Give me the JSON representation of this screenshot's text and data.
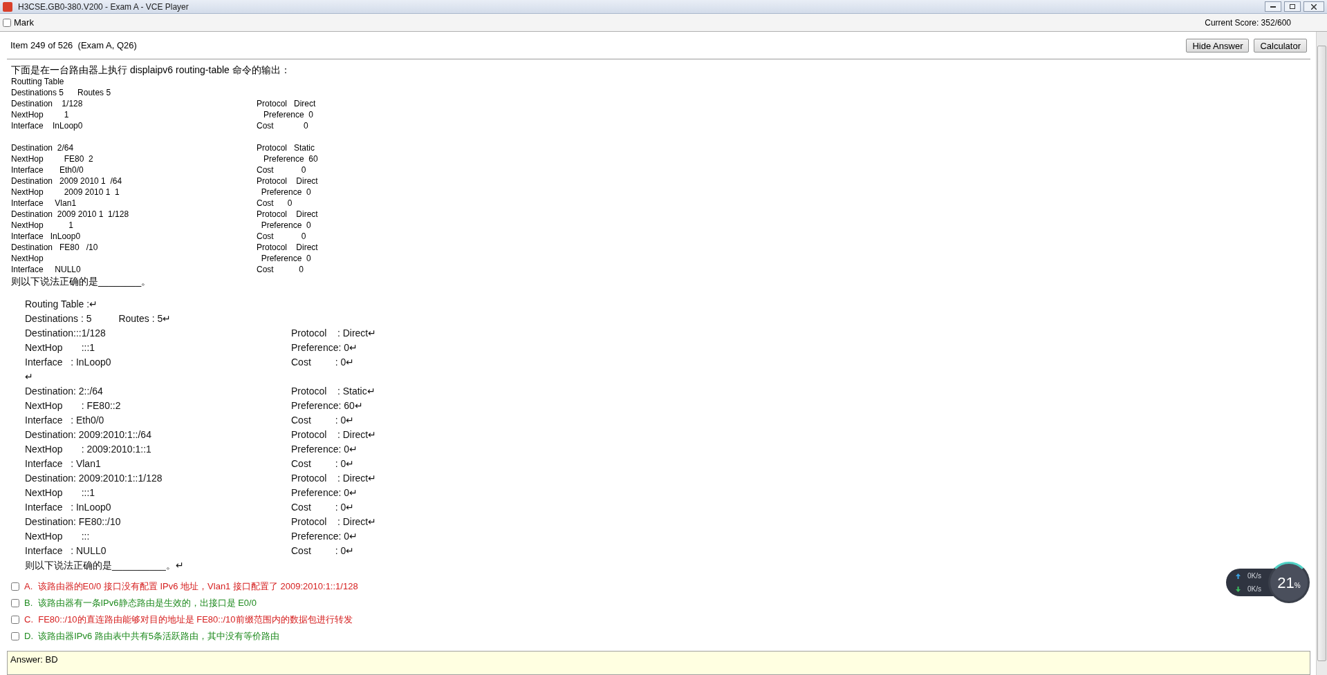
{
  "window": {
    "title": "H3CSE.GB0-380.V200 - Exam A - VCE Player"
  },
  "mark": {
    "label": "Mark",
    "checked": false
  },
  "score": "Current Score: 352/600",
  "item": "Item 249 of 526  (Exam A, Q26)",
  "buttons": [
    "Hide Answer",
    "Calculator"
  ],
  "question": {
    "intro": "下面是在一台路由器上执行 displaipv6 routing-table 命令的输出：",
    "rows": [
      {
        "left": "Routting Table",
        "right": ""
      },
      {
        "left": "Destinations 5      Routes 5",
        "right": ""
      },
      {
        "left": "Destination    1/128",
        "right": "Protocol   Direct"
      },
      {
        "left": "NextHop         1",
        "right": "   Preference  0"
      },
      {
        "left": "Interface    InLoop0",
        "right": "Cost             0"
      },
      {
        "left": "",
        "right": ""
      },
      {
        "left": "Destination  2/64",
        "right": "Protocol   Static"
      },
      {
        "left": "NextHop         FE80  2",
        "right": "   Preference  60"
      },
      {
        "left": "Interface       Eth0/0",
        "right": "Cost            0"
      },
      {
        "left": "Destination   2009 2010 1  /64",
        "right": "Protocol    Direct"
      },
      {
        "left": "NextHop         2009 2010 1  1",
        "right": "  Preference  0"
      },
      {
        "left": "Interface     Vlan1",
        "right": "Cost      0"
      },
      {
        "left": "Destination  2009 2010 1  1/128",
        "right": "Protocol    Direct"
      },
      {
        "left": "NextHop           1",
        "right": "  Preference  0"
      },
      {
        "left": "Interface   InLoop0",
        "right": "Cost            0"
      },
      {
        "left": "Destination   FE80   /10",
        "right": "Protocol    Direct"
      },
      {
        "left": "NextHop",
        "right": "  Preference  0"
      },
      {
        "left": "Interface     NULL0",
        "right": "Cost           0"
      }
    ],
    "ask": "则以下说法正确的是________。"
  },
  "document": {
    "rows": [
      {
        "left": "Routing Table :↵",
        "right": ""
      },
      {
        "left": "Destinations : 5          Routes : 5↵",
        "right": ""
      },
      {
        "left": "Destination:::1/128",
        "right": "Protocol    : Direct↵"
      },
      {
        "left": "NextHop       :::1",
        "right": "Preference: 0↵"
      },
      {
        "left": "Interface   : InLoop0",
        "right": "Cost         : 0↵"
      },
      {
        "left": "↵",
        "right": ""
      },
      {
        "left": "Destination: 2::/64",
        "right": "Protocol    : Static↵"
      },
      {
        "left": "NextHop       : FE80::2",
        "right": "Preference: 60↵"
      },
      {
        "left": "Interface   : Eth0/0",
        "right": "Cost         : 0↵"
      },
      {
        "left": "Destination: 2009:2010:1::/64",
        "right": "Protocol    : Direct↵"
      },
      {
        "left": "NextHop       : 2009:2010:1::1",
        "right": "Preference: 0↵"
      },
      {
        "left": "Interface   : Vlan1",
        "right": "Cost         : 0↵"
      },
      {
        "left": "Destination: 2009:2010:1::1/128",
        "right": "Protocol    : Direct↵"
      },
      {
        "left": "NextHop       :::1",
        "right": "Preference: 0↵"
      },
      {
        "left": "Interface   : InLoop0",
        "right": "Cost         : 0↵"
      },
      {
        "left": "Destination: FE80::/10",
        "right": "Protocol    : Direct↵"
      },
      {
        "left": "NextHop       :::",
        "right": "Preference: 0↵"
      },
      {
        "left": "Interface   : NULL0",
        "right": "Cost         : 0↵"
      }
    ],
    "ask": "则以下说法正确的是__________。↵"
  },
  "options": [
    {
      "letter": "A.",
      "text": "该路由器的E0/0 接口没有配置 IPv6 地址，Vlan1 接口配置了 2009:2010:1::1/128",
      "checked": false,
      "color": "#d62020"
    },
    {
      "letter": "B.",
      "text": "该路由器有一条IPv6静态路由是生效的，出接口是 E0/0",
      "checked": false,
      "color": "#1e8a1e"
    },
    {
      "letter": "C.",
      "text": "FE80::/10的直连路由能够对目的地址是 FE80::/10前缀范围内的数据包进行转发",
      "checked": false,
      "color": "#d62020"
    },
    {
      "letter": "D.",
      "text": "该路由器IPv6 路由表中共有5条活跃路由，其中没有等价路由",
      "checked": false,
      "color": "#1e8a1e"
    }
  ],
  "answer": "Answer: BD",
  "net_widget": {
    "up": "0K/s",
    "down": "0K/s",
    "percent": "21",
    "unit": "%"
  }
}
